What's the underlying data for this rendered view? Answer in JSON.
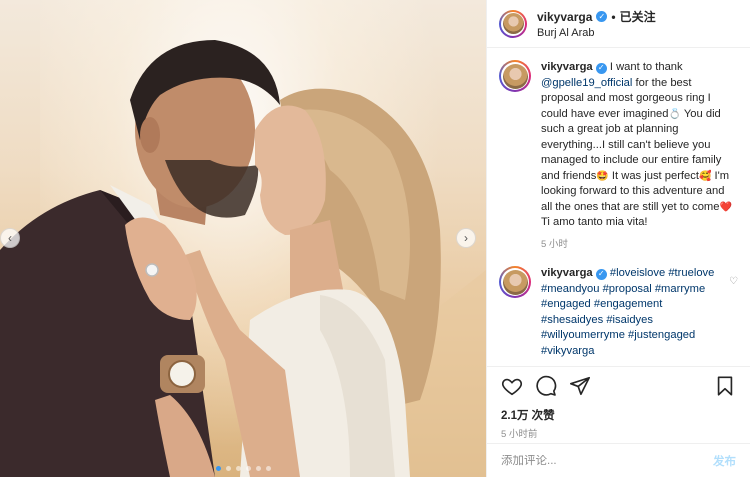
{
  "colors": {
    "accent_blue": "#3897f0",
    "link_blue": "#00376b",
    "post_disabled": "#b2dffc",
    "muted": "#8e8e8e",
    "border": "#efefef"
  },
  "header": {
    "username": "vikyvarga",
    "separator": "•",
    "follow_label": "已关注",
    "location": "Burj Al Arab"
  },
  "carousel": {
    "slide_count": 6,
    "active_index": 0,
    "prev_icon": "chevron-left-icon",
    "next_icon": "chevron-right-icon"
  },
  "caption": {
    "username": "vikyvarga",
    "parts": {
      "p1": "I want to thank",
      "mention": "@gpelle19_official",
      "p2": "for the best proposal and most gorgeous ring I could have ever imagined",
      "emoji_ring": "💍",
      "p3": "You did such a great job at planning everything...I still can't believe you managed to include our entire family and friends",
      "emoji_1": "🤩",
      "p4": "It was just perfect",
      "emoji_2": "🥰",
      "p5": "I'm looking forward to this adventure and all the ones that are still yet to come",
      "emoji_heart": "❤️",
      "p6": "Ti amo tanto mia vita!"
    },
    "time": "5 小时"
  },
  "comment2": {
    "username": "vikyvarga",
    "hashtags": [
      "#loveislove",
      "#truelove",
      "#meandyou",
      "#proposal",
      "#marryme",
      "#engaged",
      "#engagement",
      "#shesaidyes",
      "#isaidyes",
      "#willyoumerryme",
      "#justengaged",
      "#vikyvarga"
    ]
  },
  "actions": {
    "like_icon": "heart-icon",
    "comment_icon": "comment-icon",
    "share_icon": "share-icon",
    "save_icon": "bookmark-icon"
  },
  "likes_text": "2.1万 次赞",
  "post_time": "5 小时前",
  "comment_input": {
    "placeholder": "添加评论...",
    "post_label": "发布"
  }
}
